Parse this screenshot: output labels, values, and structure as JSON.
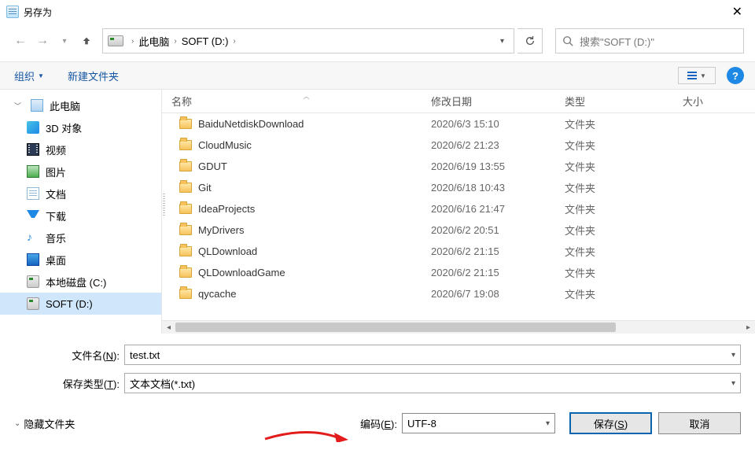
{
  "window": {
    "title": "另存为"
  },
  "nav": {
    "crumb_pc": "此电脑",
    "crumb_drive": "SOFT (D:)",
    "search_placeholder": "搜索\"SOFT (D:)\""
  },
  "toolbar": {
    "organize": "组织",
    "newfolder": "新建文件夹"
  },
  "sidebar": {
    "this_pc": "此电脑",
    "items": [
      {
        "label": "3D 对象"
      },
      {
        "label": "视频"
      },
      {
        "label": "图片"
      },
      {
        "label": "文档"
      },
      {
        "label": "下载"
      },
      {
        "label": "音乐"
      },
      {
        "label": "桌面"
      },
      {
        "label": "本地磁盘 (C:)"
      },
      {
        "label": "SOFT (D:)"
      }
    ]
  },
  "columns": {
    "name": "名称",
    "date": "修改日期",
    "type": "类型",
    "size": "大小"
  },
  "files": [
    {
      "name": "BaiduNetdiskDownload",
      "date": "2020/6/3 15:10",
      "type": "文件夹"
    },
    {
      "name": "CloudMusic",
      "date": "2020/6/2 21:23",
      "type": "文件夹"
    },
    {
      "name": "GDUT",
      "date": "2020/6/19 13:55",
      "type": "文件夹"
    },
    {
      "name": "Git",
      "date": "2020/6/18 10:43",
      "type": "文件夹"
    },
    {
      "name": "IdeaProjects",
      "date": "2020/6/16 21:47",
      "type": "文件夹"
    },
    {
      "name": "MyDrivers",
      "date": "2020/6/2 20:51",
      "type": "文件夹"
    },
    {
      "name": "QLDownload",
      "date": "2020/6/2 21:15",
      "type": "文件夹"
    },
    {
      "name": "QLDownloadGame",
      "date": "2020/6/2 21:15",
      "type": "文件夹"
    },
    {
      "name": "qycache",
      "date": "2020/6/7 19:08",
      "type": "文件夹"
    }
  ],
  "form": {
    "filename_label": "文件名(N):",
    "filename_value": "test.txt",
    "filetype_label": "保存类型(T):",
    "filetype_value": "文本文档(*.txt)"
  },
  "footer": {
    "hide_folders": "隐藏文件夹",
    "encoding_label": "编码(E):",
    "encoding_value": "UTF-8",
    "save": "保存(S)",
    "cancel": "取消"
  }
}
